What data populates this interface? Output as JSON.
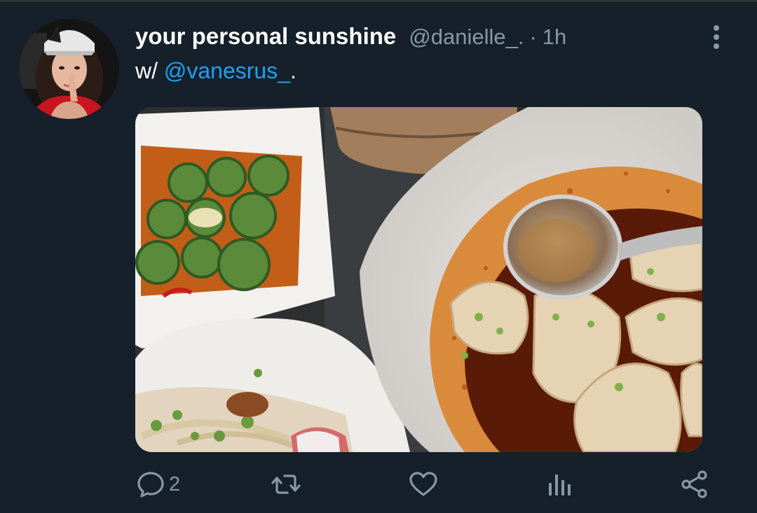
{
  "tweet": {
    "display_name": "your personal sunshine",
    "handle": "@danielle_.",
    "separator": "·",
    "time": "1h",
    "text_prefix": "w/ ",
    "mention": "@vanesrus_",
    "text_suffix": ".",
    "media_description": "",
    "actions": {
      "reply_count": "2",
      "retweet_count": "",
      "like_count": ""
    }
  },
  "colors": {
    "background": "#15202b",
    "text_primary": "#ffffff",
    "text_secondary": "#8899a6",
    "link": "#1da1f2"
  },
  "icons": {
    "more": "more-vertical-icon",
    "reply": "comment-icon",
    "retweet": "retweet-icon",
    "like": "heart-icon",
    "analytics": "analytics-icon",
    "share": "share-icon"
  }
}
